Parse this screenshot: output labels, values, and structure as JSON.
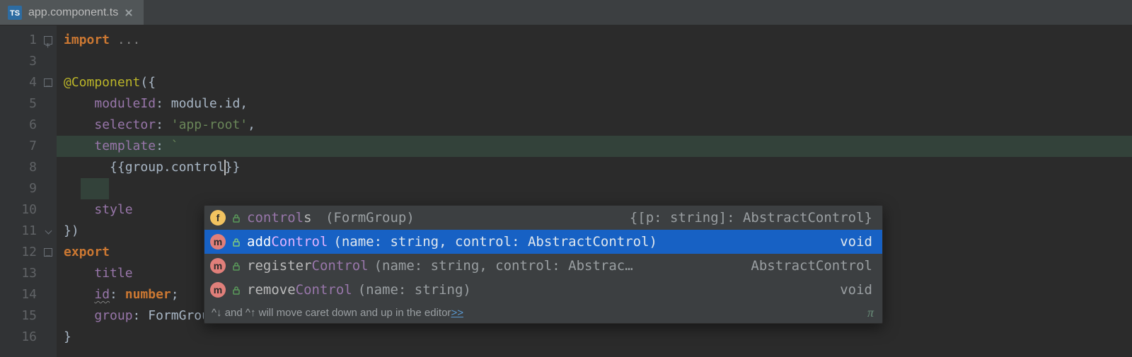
{
  "tab": {
    "filename": "app.component.ts",
    "icon": "typescript-file-icon"
  },
  "gutter": {
    "lines": [
      "1",
      "3",
      "4",
      "5",
      "6",
      "7",
      "8",
      "9",
      "10",
      "11",
      "12",
      "13",
      "14",
      "15",
      "16"
    ]
  },
  "code": {
    "l1_import": "import ",
    "l1_fold": "...",
    "l4_decor": "@Component",
    "l4_rest": "({",
    "l5_key": "moduleId",
    "l5_val": "module.id",
    "l6_key": "selector",
    "l6_val": "'app-root'",
    "l7_key": "template",
    "l8_open": "{{",
    "l8_obj": "group",
    "l8_dot": ".",
    "l8_prop": "control",
    "l8_close": "}}",
    "l9_tick": "`",
    "l9_comma": ",",
    "l10_key": "style",
    "l11": "})",
    "l12_export": "export ",
    "l13_key": "title",
    "l14_key": "id",
    "l14_type": "number",
    "l15_key": "group",
    "l15_type": "FormGroup",
    "l16": "}"
  },
  "popup": {
    "items": [
      {
        "kind": "f",
        "name_pre": "control",
        "name_suf": "s",
        "sig": " (FormGroup)",
        "ret": "{[p: string]: AbstractControl}"
      },
      {
        "kind": "m",
        "name_pre": "add",
        "name_match": "Control",
        "sig": "(name: string, control: AbstractControl)",
        "ret": "void"
      },
      {
        "kind": "m",
        "name_pre": "register",
        "name_match": "Control",
        "sig": "(name: string, control: Abstrac…",
        "ret": "AbstractControl"
      },
      {
        "kind": "m",
        "name_pre": "remove",
        "name_match": "Control",
        "sig": "(name: string)",
        "ret": "void"
      }
    ],
    "footer_hint": "^↓ and ^↑ will move caret down and up in the editor ",
    "footer_link": ">>",
    "pi": "π"
  }
}
